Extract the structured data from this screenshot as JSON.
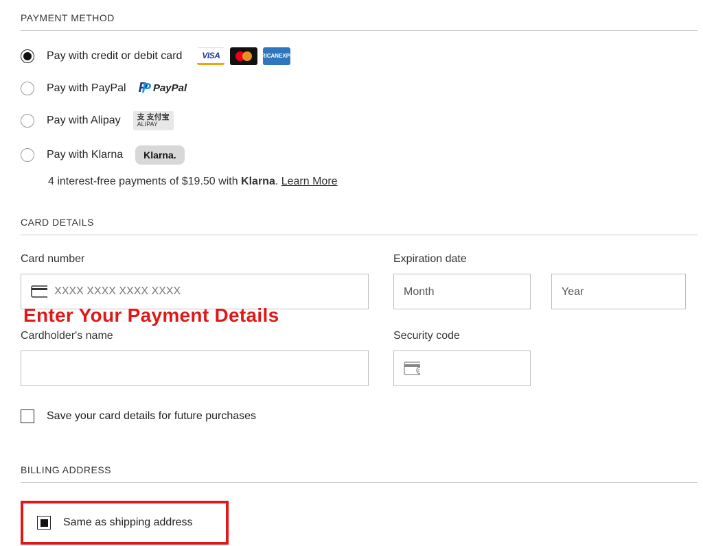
{
  "sections": {
    "payment_method_title": "PAYMENT METHOD",
    "card_details_title": "CARD DETAILS",
    "billing_title": "BILLING ADDRESS"
  },
  "payment_methods": {
    "card": "Pay with credit or debit card",
    "paypal": "Pay with PayPal",
    "alipay": "Pay with Alipay",
    "klarna": "Pay with Klarna"
  },
  "brand_text": {
    "visa": "VISA",
    "amex_line1": "AMERICAN",
    "amex_line2": "EXPRESS",
    "paypal_mark": "P",
    "paypal_text": "PayPal",
    "alipay_top": "支 支付宝",
    "alipay_bottom": "ALIPAY",
    "klarna": "Klarna."
  },
  "klarna_note": {
    "prefix": "4 interest-free payments of $19.50 with ",
    "brand": "Klarna",
    "suffix": ". ",
    "learn_more": "Learn More"
  },
  "fields": {
    "card_number_label": "Card number",
    "card_number_placeholder": "XXXX XXXX XXXX XXXX",
    "expiration_label": "Expiration date",
    "month_placeholder": "Month",
    "year_placeholder": "Year",
    "cardholder_label": "Cardholder's name",
    "security_label": "Security code"
  },
  "overlay_instruction": "Enter Your Payment Details",
  "save_card_label": "Save your card details for future purchases",
  "same_shipping_label": "Same as shipping address"
}
